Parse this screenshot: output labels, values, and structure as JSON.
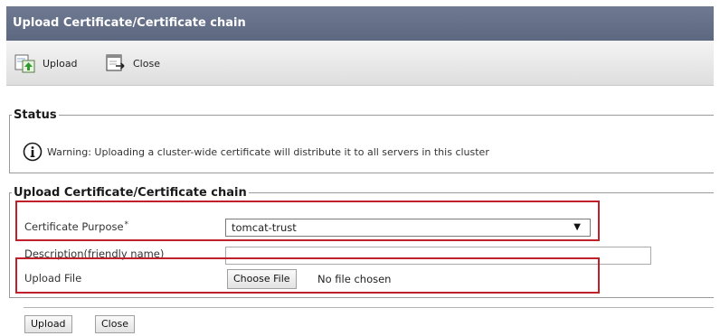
{
  "window": {
    "title": "Upload Certificate/Certificate chain"
  },
  "toolbar": {
    "upload_label": "Upload",
    "upload_icon": "upload-icon",
    "close_label": "Close",
    "close_icon": "close-window-icon"
  },
  "status": {
    "legend": "Status",
    "icon": "info-icon",
    "message": "Warning: Uploading a cluster-wide certificate will distribute it to all servers in this cluster"
  },
  "form": {
    "legend": "Upload Certificate/Certificate chain",
    "purpose_label": "Certificate Purpose",
    "purpose_required_mark": "*",
    "purpose_value": "tomcat-trust",
    "description_label": "Description(friendly name)",
    "description_value": "",
    "file_label": "Upload File",
    "choose_file_label": "Choose File",
    "file_status": "No file chosen"
  },
  "actions": {
    "upload_label": "Upload",
    "close_label": "Close"
  },
  "colors": {
    "title_bar": "#626d86",
    "highlight": "#c0202a"
  }
}
